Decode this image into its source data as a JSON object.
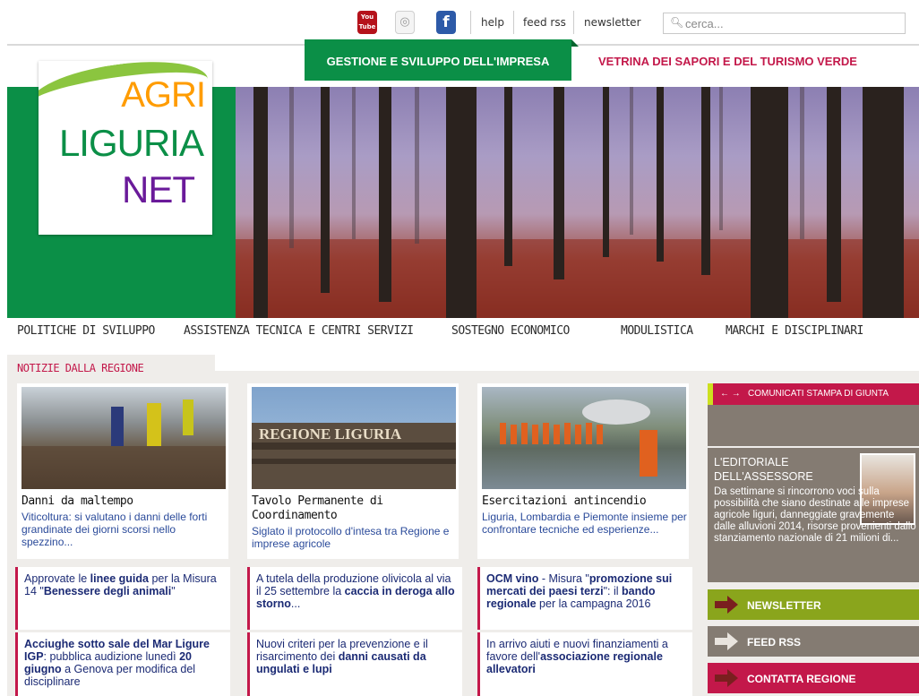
{
  "topbar": {
    "youtube_label": "You Tube",
    "links": [
      "help",
      "feed rss",
      "newsletter"
    ],
    "search_placeholder": "cerca..."
  },
  "tabs": {
    "business": "GESTIONE E SVILUPPO DELL'IMPRESA",
    "showcase": "VETRINA DEI SAPORI E DEL TURISMO VERDE"
  },
  "logo": {
    "line1": "AGRI",
    "line2": "LIGURIA",
    "line3": "NET"
  },
  "mainnav": [
    "POLITICHE DI SVILUPPO",
    "ASSISTENZA TECNICA E CENTRI SERVIZI",
    "SOSTEGNO ECONOMICO",
    "MODULISTICA",
    "MARCHI E DISCIPLINARI"
  ],
  "news": {
    "section_title": "NOTIZIE DALLA REGIONE",
    "cards": [
      {
        "title": "Danni da maltempo",
        "body": "Viticoltura: si valutano i danni delle forti grandinate dei giorni scorsi nello spezzino..."
      },
      {
        "title": "Tavolo Permanente di Coordinamento",
        "body": "Siglato il protocollo d'intesa tra Regione e imprese agricole",
        "sign_text": "REGIONE LIGURIA"
      },
      {
        "title": "Esercitazioni antincendio",
        "body": "Liguria, Lombardia e Piemonte insieme per confrontare tecniche ed esperienze..."
      }
    ],
    "items": [
      {
        "p1": "Approvate le ",
        "b1": "linee guida",
        "p2": " per la Misura 14 \"",
        "b2": "Benessere degli animali",
        "p3": "\""
      },
      {
        "p1": "A tutela della produzione olivicola al via il 25 settembre la ",
        "b1": "caccia in deroga allo storno",
        "p2": "..."
      },
      {
        "b1": "OCM vino",
        "p1": " - Misura \"",
        "b2": "promozione sui mercati dei paesi terzi",
        "p2": "\": il ",
        "b3": "bando regionale",
        "p3": " per la campagna 2016"
      },
      {
        "b1": "Acciughe sotto sale del Mar Ligure IGP",
        "p1": ": pubblica audizione lunedì ",
        "b2": "20 giugno",
        "p2": " a Genova per modifica del disciplinare"
      },
      {
        "p1": "Nuovi criteri per la prevenzione e il risarcimento dei ",
        "b1": "danni causati da ungulati e lupi"
      },
      {
        "p1": "In arrivo aiuti e nuovi finanziamenti a favore dell'",
        "b1": "associazione regionale allevatori"
      }
    ]
  },
  "sidebar": {
    "comunicati_arrows": "← →",
    "comunicati_label": "COMUNICATI STAMPA DI GIUNTA",
    "editorial_title": "L'EDITORIALE DELL'ASSESSORE",
    "editorial_text": "Da settimane si rincorrono voci sulla possibilità che siano destinate alle imprese agricole liguri, danneggiate gravemente dalle alluvioni 2014, risorse provenienti dallo stanziamento nazionale di 21 milioni di...",
    "buttons": [
      {
        "label": "NEWSLETTER",
        "color": "#8aa51c"
      },
      {
        "label": "FEED RSS",
        "color": "#847b72"
      },
      {
        "label": "CONTATTA REGIONE",
        "color": "#c3184a"
      }
    ]
  },
  "colors": {
    "brand_green": "#0b8f47",
    "accent_red": "#c3184a",
    "link_blue": "#1b2a74"
  }
}
